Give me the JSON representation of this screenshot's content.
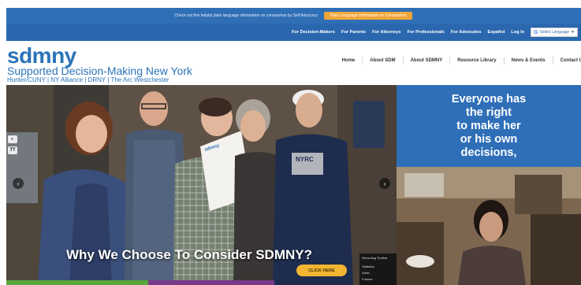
{
  "announcement": {
    "text": "Check out this helpful plain language information on coronavirus by Self Advocacy",
    "button_label": "Plain Language Information on Coronavirus"
  },
  "top_nav": {
    "items": [
      "For Decision-Makers",
      "For Parents",
      "For Attorneys",
      "For Professionals",
      "For Advocates",
      "Español",
      "Log In"
    ],
    "language_select": {
      "icon": "G",
      "label": "Select Language",
      "caret": "▼"
    }
  },
  "header": {
    "logo": "sdmny",
    "tagline": "Supported Decision-Making New York",
    "partners": "Hunter/CUNY | NY Alliance | DRNY | The Arc Westchester"
  },
  "main_nav": {
    "items": [
      "Home",
      "About SDM",
      "About SDMNY",
      "Resource Library",
      "News & Events",
      "Contact U"
    ]
  },
  "hero": {
    "caption": "Why We Choose To Consider SDMNY?",
    "cta_label": "CLICK HERE",
    "prev_arrow": "‹",
    "next_arrow": "›",
    "shirt_text": "NYRC",
    "sheet_text": "sdmny"
  },
  "side_tools": [
    "◐",
    "TT"
  ],
  "right_panel": {
    "lines": [
      "Everyone has",
      "the right",
      "to make her",
      "or his own",
      "decisions,"
    ]
  },
  "recording_toolbar": {
    "title": "Recording Toolbar",
    "rows": [
      "Statistics",
      "Webc",
      "Frames"
    ]
  },
  "colors": {
    "brand_blue": "#2a73b8",
    "nav_blue": "#2a67ae",
    "panel_blue": "#2f6fb8",
    "accent_orange": "#f0a63a",
    "cta_yellow": "#f2b632"
  }
}
